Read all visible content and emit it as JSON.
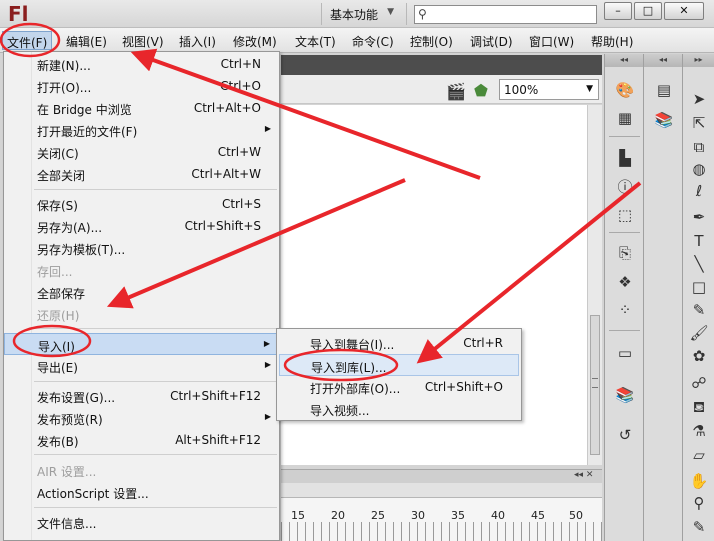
{
  "app": {
    "logo": "Fl",
    "workspace": "基本功能",
    "window_buttons": [
      "–",
      "□",
      "✕"
    ]
  },
  "menubar": {
    "items": [
      "文件(F)",
      "编辑(E)",
      "视图(V)",
      "插入(I)",
      "修改(M)",
      "文本(T)",
      "命令(C)",
      "控制(O)",
      "调试(D)",
      "窗口(W)",
      "帮助(H)"
    ]
  },
  "file_menu": {
    "items": [
      {
        "label": "新建(N)...",
        "shortcut": "Ctrl+N"
      },
      {
        "label": "打开(O)...",
        "shortcut": "Ctrl+O"
      },
      {
        "label": "在 Bridge 中浏览",
        "shortcut": "Ctrl+Alt+O"
      },
      {
        "label": "打开最近的文件(F)",
        "shortcut": ""
      },
      {
        "label": "关闭(C)",
        "shortcut": "Ctrl+W"
      },
      {
        "label": "全部关闭",
        "shortcut": "Ctrl+Alt+W"
      },
      {
        "label": "保存(S)",
        "shortcut": "Ctrl+S"
      },
      {
        "label": "另存为(A)...",
        "shortcut": "Ctrl+Shift+S"
      },
      {
        "label": "另存为模板(T)...",
        "shortcut": ""
      },
      {
        "label": "存回...",
        "shortcut": ""
      },
      {
        "label": "全部保存",
        "shortcut": ""
      },
      {
        "label": "还原(H)",
        "shortcut": ""
      },
      {
        "label": "导入(I)",
        "shortcut": ""
      },
      {
        "label": "导出(E)",
        "shortcut": ""
      },
      {
        "label": "发布设置(G)...",
        "shortcut": "Ctrl+Shift+F12"
      },
      {
        "label": "发布预览(R)",
        "shortcut": ""
      },
      {
        "label": "发布(B)",
        "shortcut": "Alt+Shift+F12"
      },
      {
        "label": "AIR 设置...",
        "shortcut": ""
      },
      {
        "label": "ActionScript 设置...",
        "shortcut": ""
      },
      {
        "label": "文件信息...",
        "shortcut": ""
      }
    ]
  },
  "import_submenu": {
    "items": [
      {
        "label": "导入到舞台(I)...",
        "shortcut": "Ctrl+R"
      },
      {
        "label": "导入到库(L)...",
        "shortcut": ""
      },
      {
        "label": "打开外部库(O)...",
        "shortcut": "Ctrl+Shift+O"
      },
      {
        "label": "导入视频...",
        "shortcut": ""
      }
    ]
  },
  "document": {
    "zoom": "100%"
  },
  "timeline": {
    "frame_labels": [
      "15",
      "20",
      "25",
      "30",
      "35",
      "40",
      "45",
      "50"
    ]
  },
  "colors": {
    "annotation_red": "#e8262b",
    "menu_highlight": "#c9dcf3",
    "logo_red": "#8a1e1e"
  }
}
